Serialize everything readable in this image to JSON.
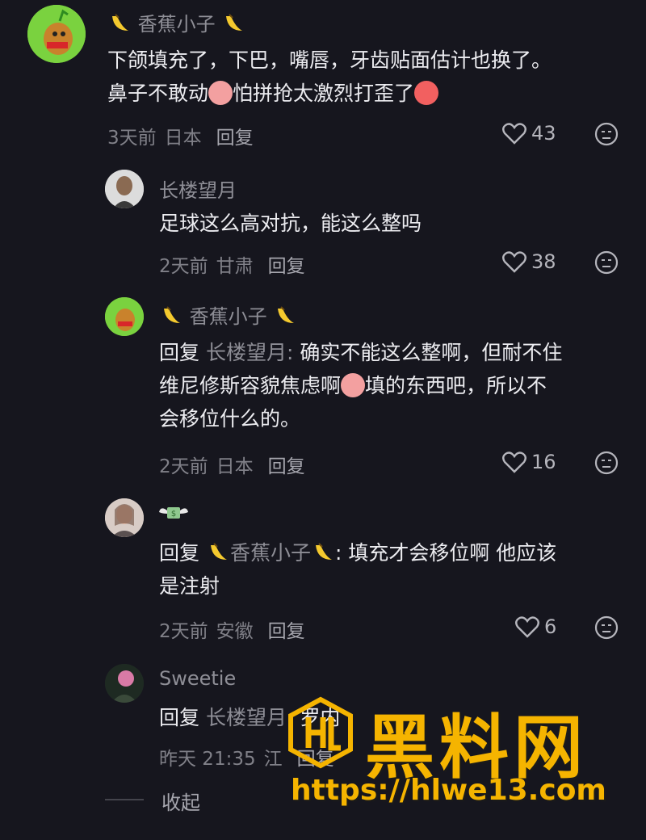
{
  "comments": [
    {
      "username": "香蕉小子",
      "line1": "下颌填充了，下巴，嘴唇，牙齿贴面估计也换了。",
      "line2a": "鼻子不敢动",
      "line2b": "怕拼抢太激烈打歪了",
      "time": "3天前",
      "location": "日本",
      "reply_label": "回复",
      "likes": "43"
    },
    {
      "username": "长楼望月",
      "line1": "足球这么高对抗，能这么整吗",
      "time": "2天前",
      "location": "甘肃",
      "reply_label": "回复",
      "likes": "38"
    },
    {
      "username": "香蕉小子",
      "reply_prefix": "回复",
      "reply_target": "长楼望月:",
      "line1": "确实不能这么整啊，但耐不住",
      "line2a": "维尼修斯容貌焦虑啊",
      "line2b": "填的东西吧，所以不",
      "line3": "会移位什么的。",
      "time": "2天前",
      "location": "日本",
      "reply_label": "回复",
      "likes": "16"
    },
    {
      "username": "",
      "reply_prefix": "回复",
      "reply_target": "香蕉小子",
      "line1": ": 填充才会移位啊 他应该",
      "line2": "是注射",
      "time": "2天前",
      "location": "安徽",
      "reply_label": "回复",
      "likes": "6"
    },
    {
      "username": "Sweetie",
      "reply_prefix": "回复",
      "reply_target": "长楼望月:",
      "line1": "罗内",
      "time": "昨天 21:35",
      "location": "江",
      "reply_label": "回复"
    }
  ],
  "collapse_label": "收起",
  "watermark": {
    "title": "黑料网",
    "url": "https://hlwe13.com"
  },
  "colors": {
    "background": "#16161e",
    "text": "#ececf0",
    "muted": "#8e8e96",
    "watermark": "#f5b400"
  }
}
